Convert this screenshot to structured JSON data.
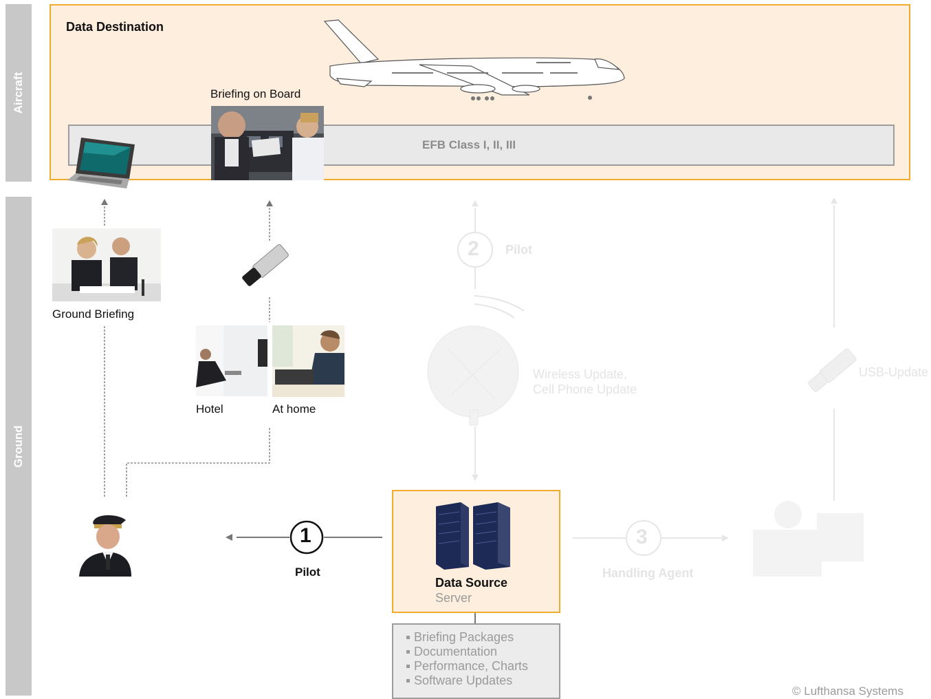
{
  "bands": {
    "aircraft": "Aircraft",
    "ground": "Ground"
  },
  "destination": {
    "title": "Data Destination",
    "efb_label": "EFB Class I, II, III",
    "briefing_on_board": "Briefing on Board"
  },
  "ground": {
    "ground_briefing": "Ground Briefing",
    "hotel": "Hotel",
    "at_home": "At home"
  },
  "routes": {
    "route1": {
      "number": "1",
      "label": "Pilot"
    },
    "route2": {
      "number": "2",
      "label": "Pilot",
      "wireless_line1": "Wireless Update,",
      "wireless_line2": "Cell Phone Update"
    },
    "route3": {
      "number": "3",
      "label": "Handling Agent"
    },
    "usb_update": "USB-Update"
  },
  "data_source": {
    "title": "Data Source",
    "subtitle": "Server",
    "items": [
      "Briefing Packages",
      "Documentation",
      "Performance, Charts",
      "Software Updates"
    ]
  },
  "copyright": "© Lufthansa Systems",
  "colors": {
    "accent_orange": "#f0aa2c",
    "box_fill": "#fdeedd",
    "band_gray": "#c8c8c8",
    "faded": "#e4e4e4"
  }
}
